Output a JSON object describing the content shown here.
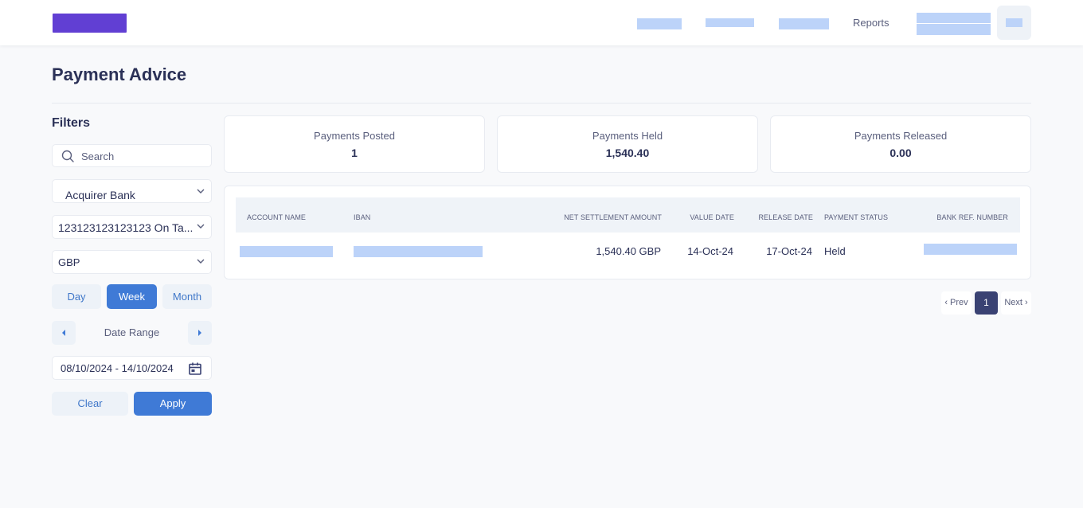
{
  "header": {
    "logo": "brand-logo",
    "nav": [
      {
        "label": "",
        "redacted": true
      },
      {
        "label": "",
        "redacted": true
      },
      {
        "label": "",
        "redacted": true
      },
      {
        "label": "Reports",
        "redacted": false
      }
    ],
    "user": {
      "redacted": true
    },
    "colors": {
      "logo": "#613fd3",
      "redaction": "#bcd3f9"
    }
  },
  "page": {
    "title": "Payment Advice"
  },
  "filters": {
    "title": "Filters",
    "search_placeholder": "Search",
    "acquirer_bank": "Acquirer Bank",
    "account": "123123123123123 On Ta...",
    "currency": "GBP",
    "period_tabs": [
      {
        "label": "Day",
        "active": false
      },
      {
        "label": "Week",
        "active": true
      },
      {
        "label": "Month",
        "active": false
      }
    ],
    "date_range_label": "Date Range",
    "date_range_value": "08/10/2024 - 14/10/2024",
    "clear_label": "Clear",
    "apply_label": "Apply"
  },
  "summary": [
    {
      "label": "Payments Posted",
      "value": "1"
    },
    {
      "label": "Payments Held",
      "value": "1,540.40"
    },
    {
      "label": "Payments Released",
      "value": "0.00"
    }
  ],
  "table": {
    "columns": [
      "ACCOUNT NAME",
      "IBAN",
      "NET SETTLEMENT AMOUNT",
      "VALUE DATE",
      "RELEASE DATE",
      "PAYMENT STATUS",
      "BANK REF. NUMBER"
    ],
    "rows": [
      {
        "account_name": "",
        "iban": "",
        "net_settlement_amount": "1,540.40 GBP",
        "value_date": "14-Oct-24",
        "release_date": "17-Oct-24",
        "payment_status": "Held",
        "bank_ref_number": ""
      }
    ]
  },
  "pagination": {
    "prev_label": "‹ Prev",
    "current_page": "1",
    "next_label": "Next ›"
  },
  "colors": {
    "primary": "#3f7ad6",
    "page_active": "#3a4273",
    "text_dark": "#2b3157",
    "text_muted": "#5a5f7d"
  }
}
